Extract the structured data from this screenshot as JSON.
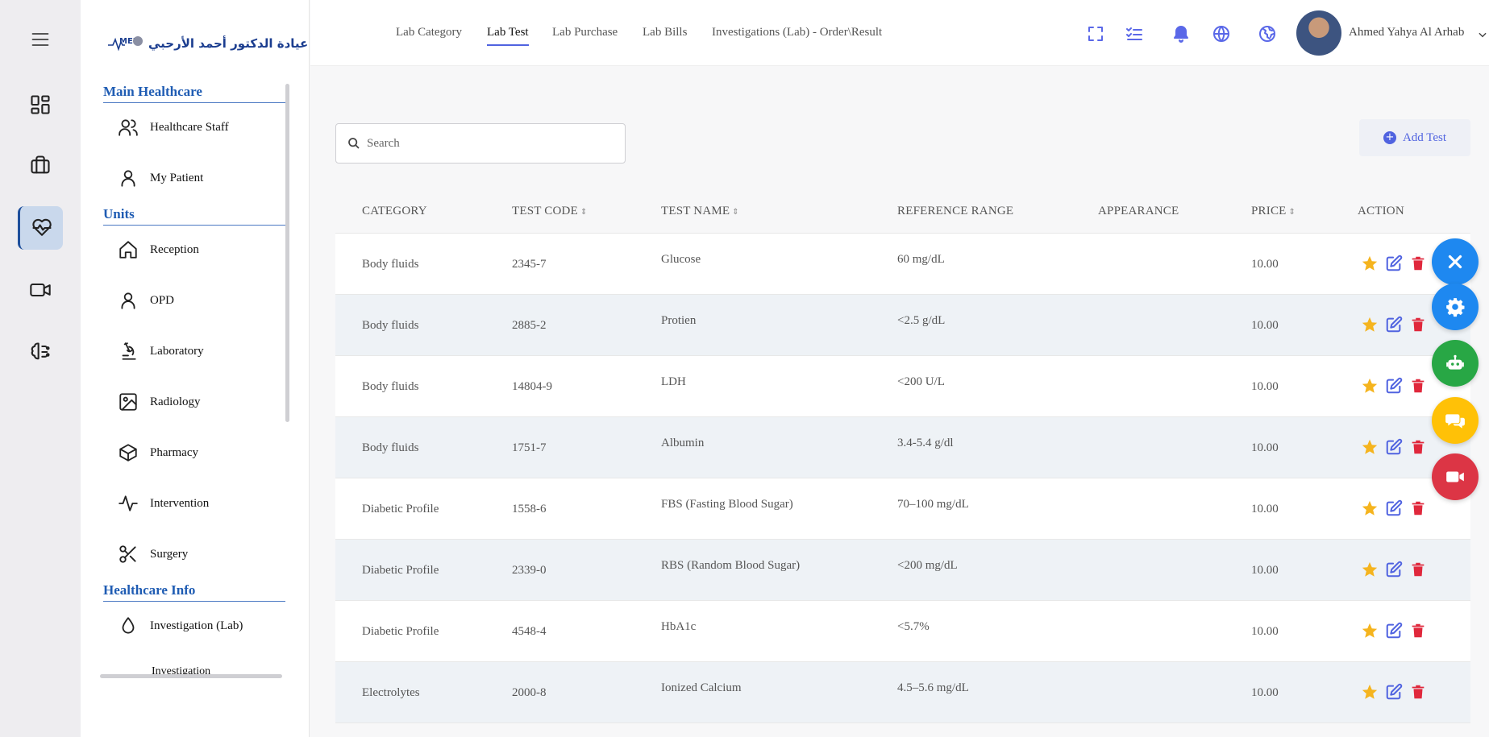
{
  "sidebar": {
    "logo_text": "عيادة الدكتور أحمد الأرحبي",
    "logo_mark": "MED",
    "sections": [
      {
        "title": "Main Healthcare"
      },
      {
        "title": "Units"
      },
      {
        "title": "Healthcare Info"
      }
    ],
    "items": {
      "healthcare_staff": "Healthcare Staff",
      "my_patient": "My Patient",
      "reception": "Reception",
      "opd": "OPD",
      "laboratory": "Laboratory",
      "radiology": "Radiology",
      "pharmacy": "Pharmacy",
      "intervention": "Intervention",
      "surgery": "Surgery",
      "investigation_lab": "Investigation (Lab)",
      "investigation_cut": "Investigation"
    }
  },
  "topbar": {
    "tabs": [
      {
        "label": "Lab Category",
        "active": false
      },
      {
        "label": "Lab Test",
        "active": true
      },
      {
        "label": "Lab Purchase",
        "active": false
      },
      {
        "label": "Lab Bills",
        "active": false
      },
      {
        "label": "Investigations (Lab) - Order\\Result",
        "active": false
      }
    ],
    "user_name": "Ahmed Yahya Al Arhab",
    "accent": "#5063e0"
  },
  "content": {
    "search_placeholder": "Search",
    "add_button_label": "Add Test",
    "columns": [
      "CATEGORY",
      "TEST CODE",
      "TEST NAME",
      "REFERENCE RANGE",
      "APPEARANCE",
      "PRICE",
      "ACTION"
    ],
    "sortable": [
      false,
      true,
      true,
      false,
      false,
      true,
      false
    ],
    "rows": [
      {
        "category": "Body fluids",
        "code": "2345-7",
        "name": "Glucose",
        "range": "60 mg/dL",
        "appearance": "",
        "price": "10.00"
      },
      {
        "category": "Body fluids",
        "code": "2885-2",
        "name": "Protien",
        "range": "<2.5 g/dL",
        "appearance": "",
        "price": "10.00"
      },
      {
        "category": "Body fluids",
        "code": "14804-9",
        "name": "LDH",
        "range": "<200 U/L",
        "appearance": "",
        "price": "10.00"
      },
      {
        "category": "Body fluids",
        "code": "1751-7",
        "name": "Albumin",
        "range": "3.4-5.4 g/dl",
        "appearance": "",
        "price": "10.00"
      },
      {
        "category": "Diabetic Profile",
        "code": "1558-6",
        "name": "FBS (Fasting Blood Sugar)",
        "range": "70–100 mg/dL",
        "appearance": "",
        "price": "10.00"
      },
      {
        "category": "Diabetic Profile",
        "code": "2339-0",
        "name": "RBS (Random Blood Sugar)",
        "range": "<200 mg/dL",
        "appearance": "",
        "price": "10.00"
      },
      {
        "category": "Diabetic Profile",
        "code": "4548-4",
        "name": "HbA1c",
        "range": "<5.7%",
        "appearance": "",
        "price": "10.00"
      },
      {
        "category": "Electrolytes",
        "code": "2000-8",
        "name": "Ionized Calcium",
        "range": "4.5–5.6 mg/dL",
        "appearance": "",
        "price": "10.00"
      }
    ]
  },
  "colors": {
    "star": "#f5b41e",
    "edit": "#5063e0",
    "delete": "#e0283c",
    "fab_close": "#1e88f0",
    "fab_settings": "#1e88f0",
    "fab_bot": "#28a745",
    "fab_chat": "#ffc107",
    "fab_video": "#dc3545"
  }
}
